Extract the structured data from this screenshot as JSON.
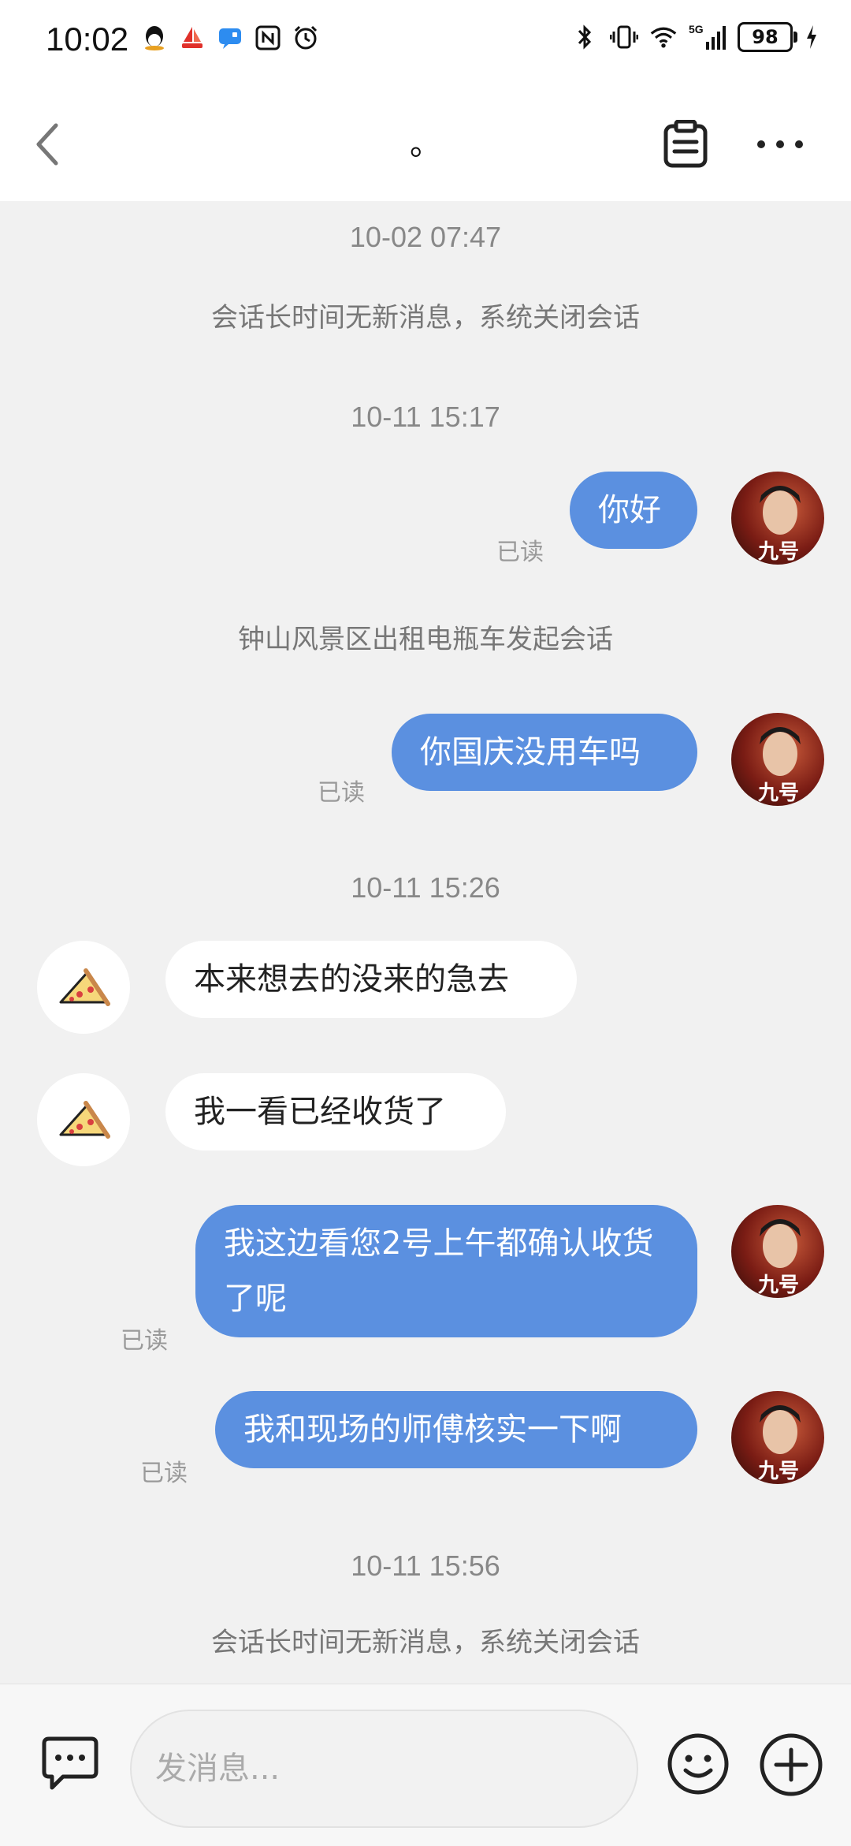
{
  "status_bar": {
    "time": "10:02",
    "battery": "98",
    "network": "5G"
  },
  "header": {
    "title": "。",
    "back_icon": "chevron-left-icon",
    "note_icon": "clipboard-icon",
    "more_icon": "more-horizontal-icon"
  },
  "messages": {
    "ts1": "10-02 07:47",
    "sys1": "会话长时间无新消息，系统关闭会话",
    "ts2": "10-11 15:17",
    "m1": "你好",
    "m1_read": "已读",
    "sys2": "钟山风景区出租电瓶车发起会话",
    "m2": "你国庆没用车吗",
    "m2_read": "已读",
    "ts3": "10-11 15:26",
    "m3": "本来想去的没来的急去",
    "m4": "我一看已经收货了",
    "m5": "我这边看您2号上午都确认收货了呢",
    "m5_read": "已读",
    "m6": "我和现场的师傅核实一下啊",
    "m6_read": "已读",
    "ts4": "10-11 15:56",
    "sys3": "会话长时间无新消息，系统关闭会话"
  },
  "input": {
    "placeholder": "发消息..."
  },
  "colors": {
    "accent_bubble": "#5b90e0",
    "background": "#f1f1f1"
  }
}
